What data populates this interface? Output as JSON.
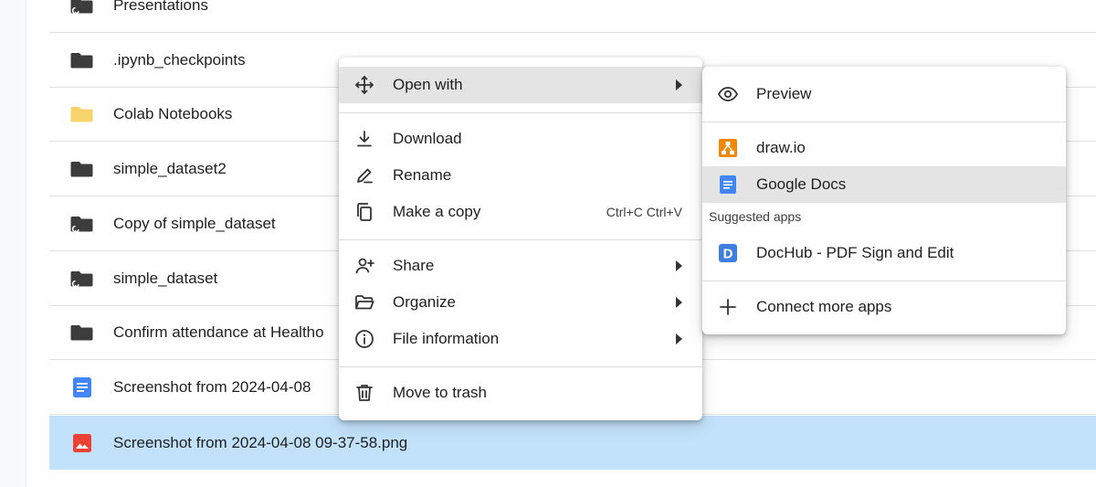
{
  "files": [
    {
      "name": "Presentations",
      "icon": "shared-folder-icon"
    },
    {
      "name": ".ipynb_checkpoints",
      "icon": "folder-icon"
    },
    {
      "name": "Colab Notebooks",
      "icon": "folder-yellow-icon"
    },
    {
      "name": "simple_dataset2",
      "icon": "folder-icon"
    },
    {
      "name": "Copy of simple_dataset",
      "icon": "shared-folder-icon"
    },
    {
      "name": "simple_dataset",
      "icon": "shared-folder-icon"
    },
    {
      "name": "Confirm attendance at Healtho",
      "icon": "folder-icon"
    },
    {
      "name": "Screenshot from 2024-04-08",
      "icon": "google-doc-icon"
    },
    {
      "name": "Screenshot from 2024-04-08 09-37-58.png",
      "icon": "image-file-icon",
      "selected": true
    }
  ],
  "context_menu": {
    "open_with": "Open with",
    "download": "Download",
    "rename": "Rename",
    "make_copy": "Make a copy",
    "make_copy_shortcut": "Ctrl+C Ctrl+V",
    "share": "Share",
    "organize": "Organize",
    "file_information": "File information",
    "move_to_trash": "Move to trash"
  },
  "open_with_submenu": {
    "preview": "Preview",
    "drawio": "draw.io",
    "google_docs": "Google Docs",
    "suggested_heading": "Suggested apps",
    "dochub": "DocHub - PDF Sign and Edit",
    "connect_more": "Connect more apps"
  },
  "colors": {
    "selected_row": "#c2e2fb",
    "highlight": "#e4e4e4",
    "folder": "#3c3c3c",
    "folder_yellow": "#f6d36b",
    "docs_blue": "#4285f4",
    "image_red": "#ea4335",
    "drawio_orange": "#f08705"
  }
}
